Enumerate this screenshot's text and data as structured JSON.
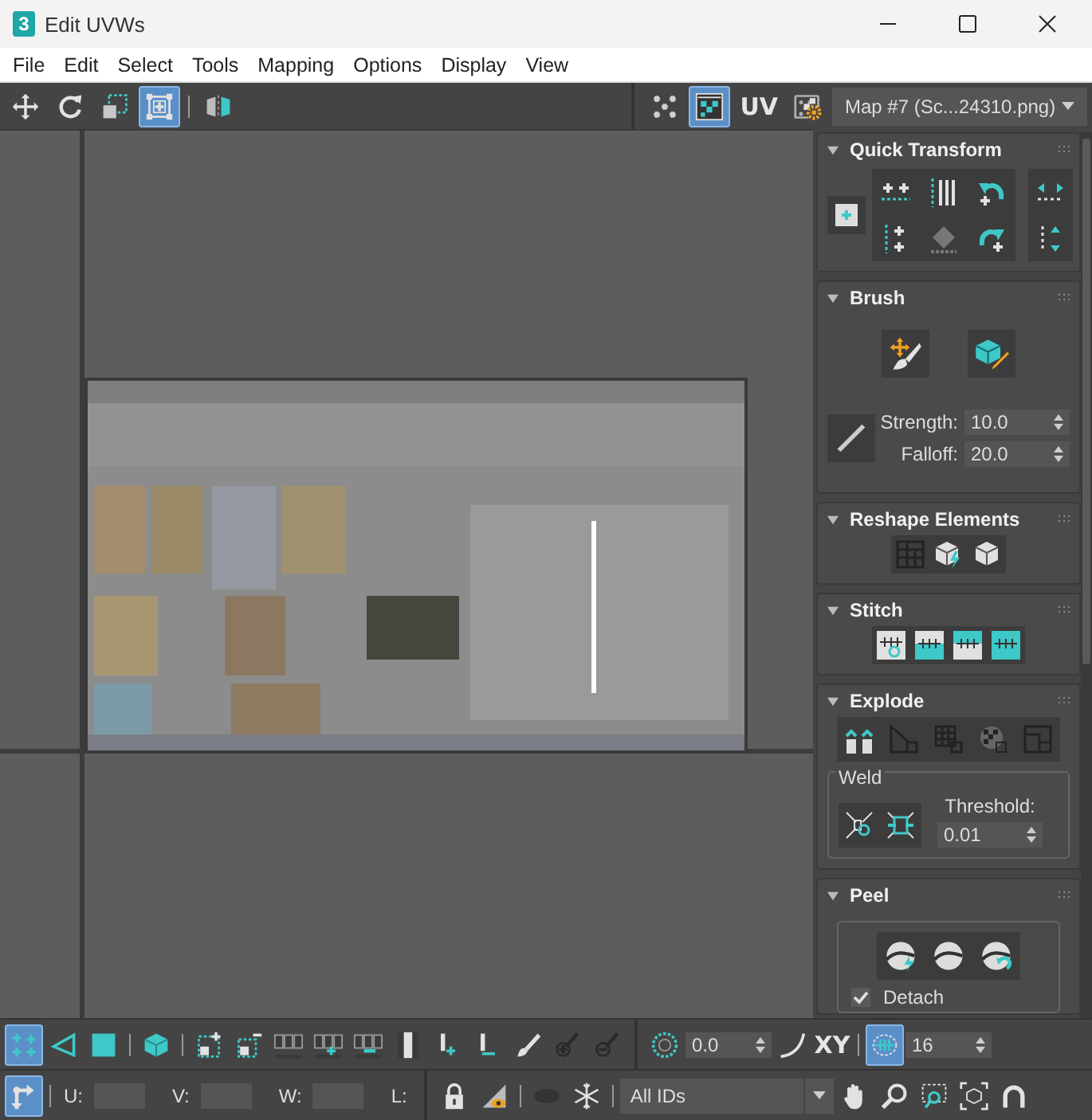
{
  "window": {
    "icon": "3",
    "title": "Edit UVWs"
  },
  "menu": [
    "File",
    "Edit",
    "Select",
    "Tools",
    "Mapping",
    "Options",
    "Display",
    "View"
  ],
  "top_toolbar": {
    "left": [
      {
        "kind": "move",
        "active": false
      },
      {
        "kind": "rotate",
        "active": false
      },
      {
        "kind": "scale",
        "active": false
      },
      {
        "kind": "freeform",
        "active": true
      },
      {
        "kind": "separator"
      },
      {
        "kind": "mirror",
        "active": false
      }
    ],
    "right": [
      {
        "kind": "checker"
      },
      {
        "kind": "checker_display",
        "active": true
      },
      {
        "kind": "text",
        "label": "UV",
        "active": false
      },
      {
        "kind": "checker_settings"
      }
    ],
    "map_dropdown": "Map #7 (Sc...24310.png)"
  },
  "rollouts": [
    {
      "kind": "quick_transform",
      "title": "Quick Transform",
      "expanded": true
    },
    {
      "kind": "brush",
      "title": "Brush",
      "expanded": true,
      "strength_label": "Strength:",
      "strength": "10.0",
      "falloff_label": "Falloff:",
      "falloff": "20.0"
    },
    {
      "kind": "reshape",
      "title": "Reshape Elements",
      "expanded": true
    },
    {
      "kind": "stitch",
      "title": "Stitch",
      "expanded": true
    },
    {
      "kind": "explode",
      "title": "Explode",
      "expanded": true,
      "weld_label": "Weld",
      "threshold_label": "Threshold:",
      "threshold": "0.01"
    },
    {
      "kind": "peel",
      "title": "Peel",
      "expanded": true,
      "detach_label": "Detach",
      "detach_checked": true
    }
  ],
  "bottom_toolbar_1": [
    {
      "kind": "vertex",
      "active": true
    },
    {
      "kind": "edge",
      "active": false
    },
    {
      "kind": "face",
      "active": false
    },
    {
      "kind": "separator"
    },
    {
      "kind": "element",
      "active": false
    },
    {
      "kind": "separator"
    },
    {
      "kind": "grow",
      "active": false
    },
    {
      "kind": "shrink",
      "active": false
    },
    {
      "kind": "loop",
      "active": false
    },
    {
      "kind": "loop_grow",
      "active": false
    },
    {
      "kind": "loop_shrink",
      "active": false
    },
    {
      "kind": "ring",
      "active": false
    },
    {
      "kind": "ring_grow",
      "active": false
    },
    {
      "kind": "ring_shrink",
      "active": false
    },
    {
      "kind": "paint",
      "active": false
    },
    {
      "kind": "paint_grow",
      "active": false
    },
    {
      "kind": "paint_shrink",
      "active": false
    },
    {
      "kind": "divider"
    },
    {
      "kind": "soft_select",
      "active": false
    },
    {
      "kind": "spinner",
      "value": "0.0"
    },
    {
      "kind": "falloff_curve",
      "active": false
    },
    {
      "kind": "text",
      "label": "XY",
      "active": false
    },
    {
      "kind": "separator"
    },
    {
      "kind": "pixel_snap",
      "active": true
    },
    {
      "kind": "spinner",
      "value": "16"
    }
  ],
  "bottom_toolbar_2": [
    {
      "kind": "transform",
      "active": true
    },
    {
      "kind": "separator"
    },
    {
      "kind": "field",
      "label": "U:"
    },
    {
      "kind": "field",
      "label": "V:"
    },
    {
      "kind": "field",
      "label": "W:"
    },
    {
      "kind": "label",
      "label": "L:"
    },
    {
      "kind": "divider"
    },
    {
      "kind": "lock",
      "active": false
    },
    {
      "kind": "visibility",
      "active": false
    },
    {
      "kind": "separator"
    },
    {
      "kind": "hide",
      "active": false
    },
    {
      "kind": "freeze",
      "active": false
    },
    {
      "kind": "separator"
    },
    {
      "kind": "dropdown",
      "value": "All IDs"
    },
    {
      "kind": "pan",
      "active": false
    },
    {
      "kind": "zoom",
      "active": false
    },
    {
      "kind": "zoom_region",
      "active": false
    },
    {
      "kind": "zoom_extents",
      "active": false
    },
    {
      "kind": "snap",
      "active": false
    }
  ]
}
